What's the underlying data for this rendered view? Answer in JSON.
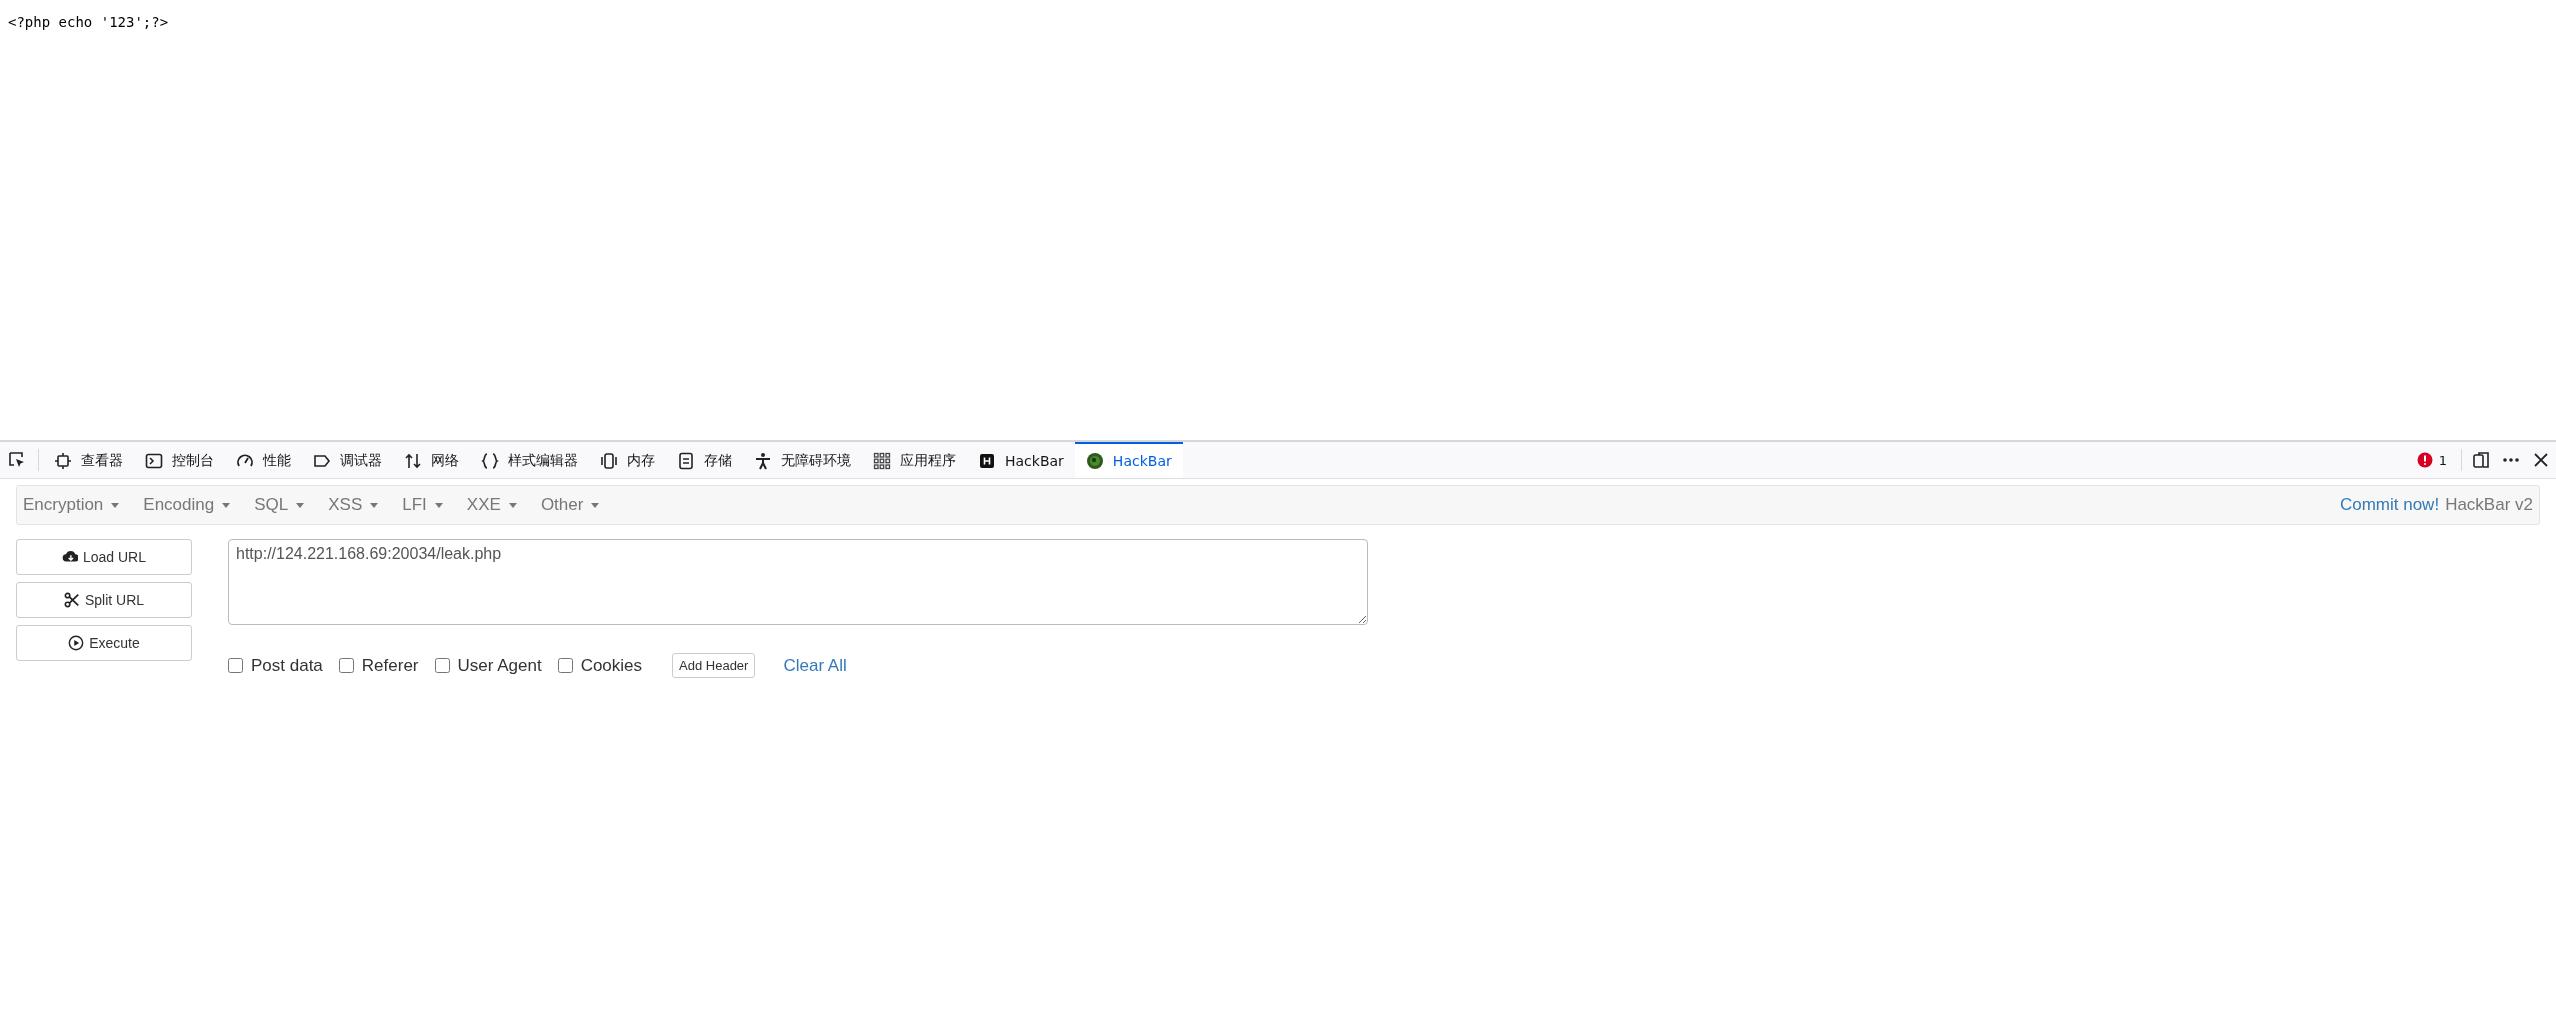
{
  "page_source": "<?php echo '123';?>",
  "devtools": {
    "tabs": [
      {
        "label": "查看器",
        "selected": false
      },
      {
        "label": "控制台",
        "selected": false
      },
      {
        "label": "性能",
        "selected": false
      },
      {
        "label": "调试器",
        "selected": false
      },
      {
        "label": "网络",
        "selected": false
      },
      {
        "label": "样式编辑器",
        "selected": false
      },
      {
        "label": "内存",
        "selected": false
      },
      {
        "label": "存储",
        "selected": false
      },
      {
        "label": "无障碍环境",
        "selected": false
      },
      {
        "label": "应用程序",
        "selected": false
      },
      {
        "label": "HackBar",
        "selected": false
      },
      {
        "label": "HackBar",
        "selected": true
      }
    ],
    "error_count": "1"
  },
  "hackbar": {
    "menus": [
      "Encryption",
      "Encoding",
      "SQL",
      "XSS",
      "LFI",
      "XXE",
      "Other"
    ],
    "commit_link": "Commit now!",
    "version": "HackBar v2",
    "buttons": [
      "Load URL",
      "Split URL",
      "Execute"
    ],
    "url": "http://124.221.168.69:20034/leak.php",
    "options": [
      {
        "label": "Post data",
        "checked": false
      },
      {
        "label": "Referer",
        "checked": false
      },
      {
        "label": "User Agent",
        "checked": false
      },
      {
        "label": "Cookies",
        "checked": false
      }
    ],
    "add_header": "Add Header",
    "clear_all": "Clear All"
  }
}
